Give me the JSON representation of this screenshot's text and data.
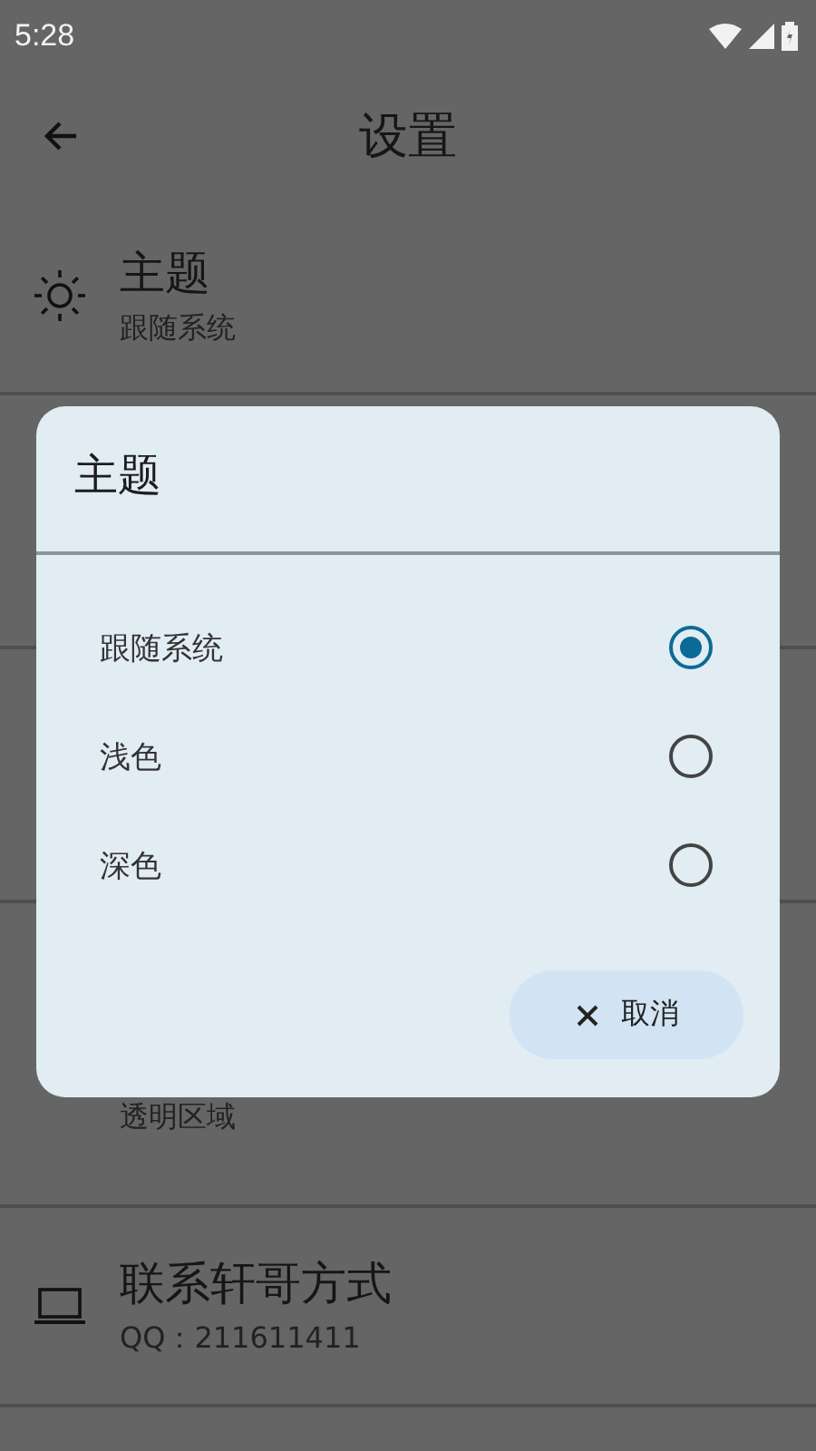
{
  "status_bar": {
    "time": "5:28"
  },
  "app_bar": {
    "title": "设置"
  },
  "settings": [
    {
      "kind": "theme",
      "title": "主题",
      "subtitle": "跟随系统"
    },
    {
      "kind": "hidden"
    },
    {
      "kind": "hidden"
    },
    {
      "kind": "partial",
      "subtitle": "透明区域"
    },
    {
      "kind": "contact",
      "title": "联系轩哥方式",
      "subtitle": "QQ：211611411"
    }
  ],
  "dialog": {
    "title": "主题",
    "options": [
      {
        "label": "跟随系统",
        "selected": true
      },
      {
        "label": "浅色",
        "selected": false
      },
      {
        "label": "深色",
        "selected": false
      }
    ],
    "cancel": "取消"
  }
}
